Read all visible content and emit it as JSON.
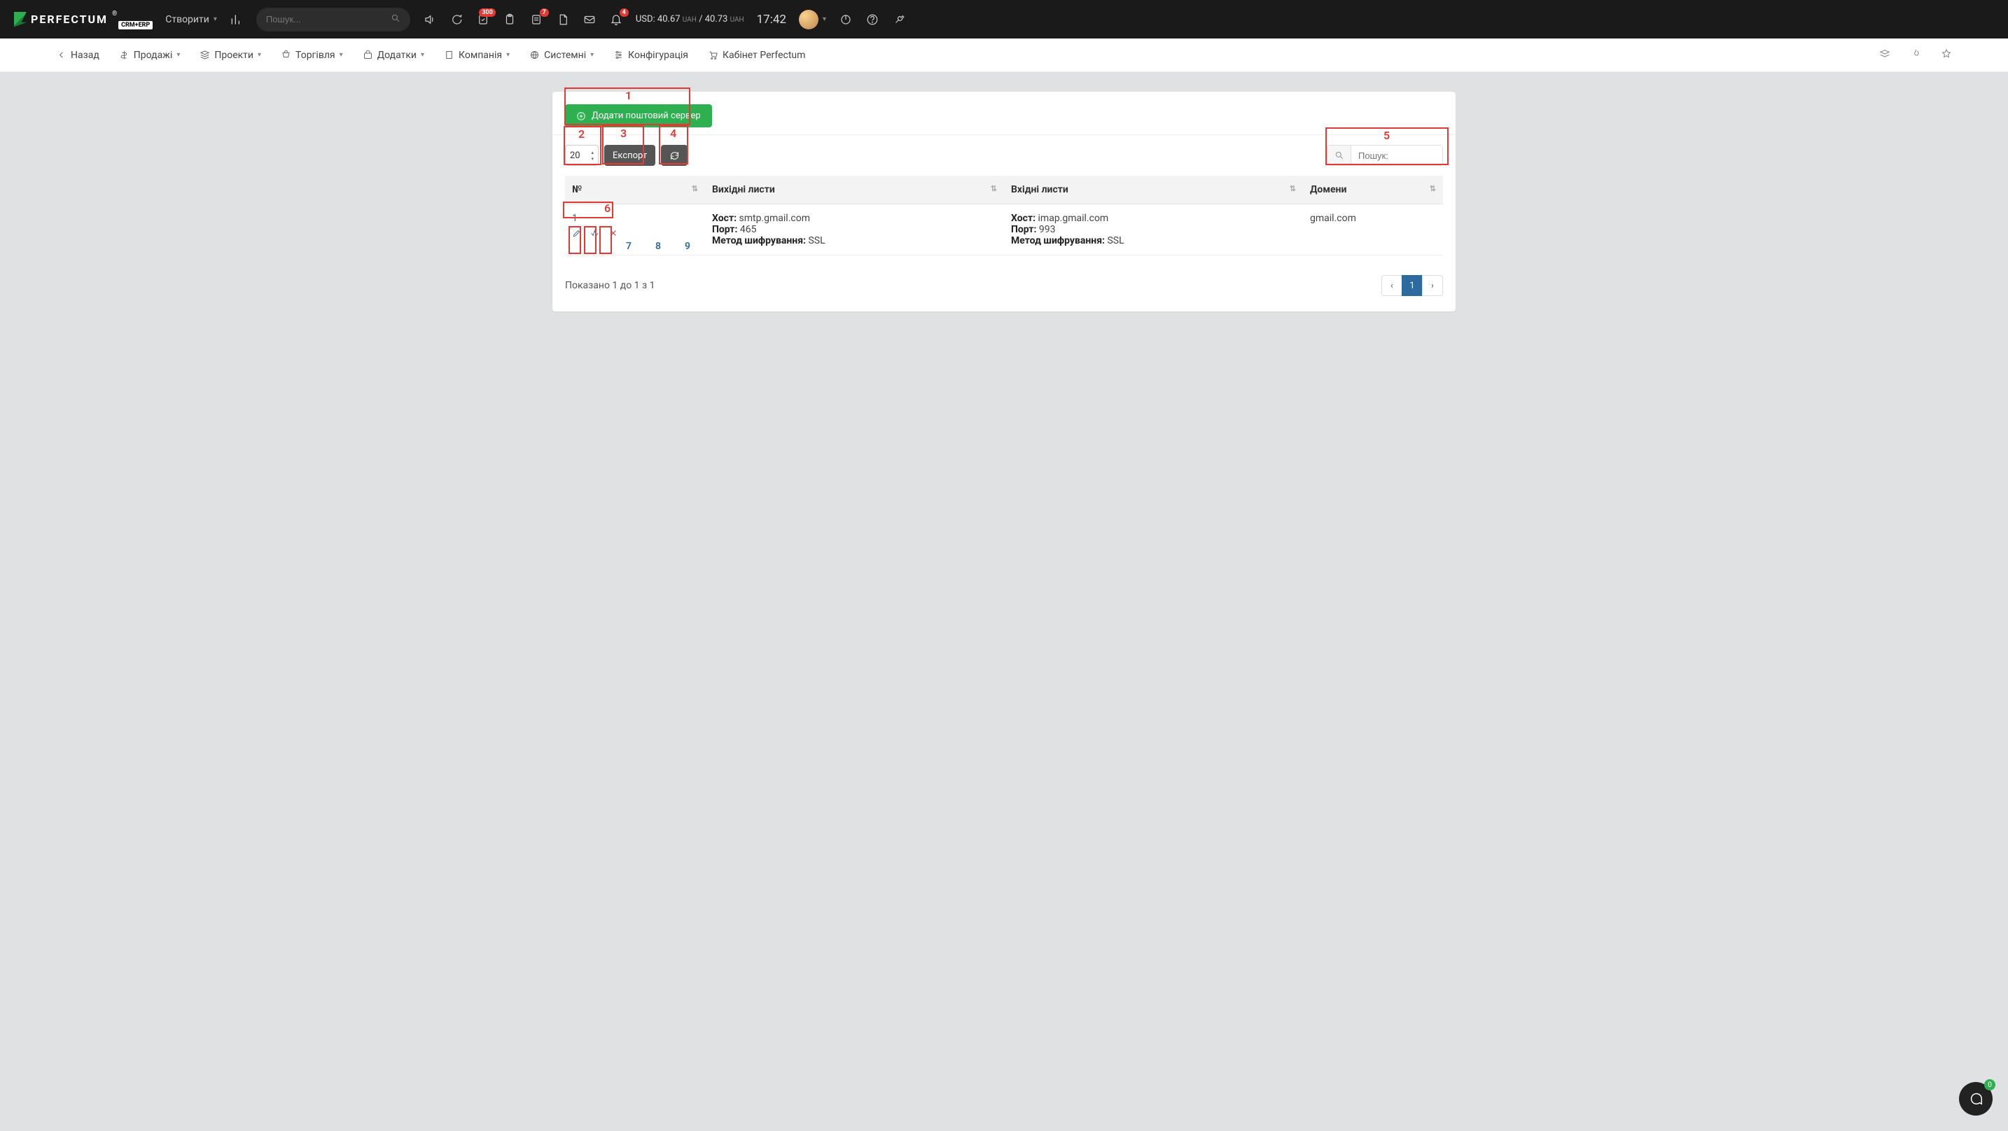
{
  "topbar": {
    "logo_text": "PERFECTUM",
    "logo_sub": "CRM+ERP",
    "logo_reg": "®",
    "create_label": "Створити",
    "search_placeholder": "Пошук...",
    "badges": {
      "todo": "300",
      "msg": "7",
      "bell": "4"
    },
    "currency": {
      "pair": "USD:",
      "buy": "40.67",
      "sell": "40.73",
      "unit": "UAH",
      "sep": "/"
    },
    "clock": "17:42"
  },
  "subnav": {
    "back": "Назад",
    "items": [
      "Продажі",
      "Проекти",
      "Торгівля",
      "Додатки",
      "Компанія",
      "Системні",
      "Конфігурація",
      "Кабінет Perfectum"
    ]
  },
  "page": {
    "add_button": "Додати поштовий сервер",
    "page_size_value": "20",
    "export_label": "Експорт",
    "table_search_placeholder": "Пошук:"
  },
  "annotations": [
    "1",
    "2",
    "3",
    "4",
    "5",
    "6",
    "7",
    "8",
    "9"
  ],
  "table": {
    "headers": [
      "№",
      "Вихідні листи",
      "Вхідні листи",
      "Домени"
    ],
    "labels": {
      "host": "Хост:",
      "port": "Порт:",
      "enc": "Метод шифрування:"
    },
    "rows": [
      {
        "num": "1",
        "out": {
          "host": "smtp.gmail.com",
          "port": "465",
          "enc": "SSL"
        },
        "in": {
          "host": "imap.gmail.com",
          "port": "993",
          "enc": "SSL"
        },
        "domain": "gmail.com"
      }
    ]
  },
  "footer": {
    "info": "Показано 1 до 1 з 1",
    "page": "1"
  },
  "chat": {
    "count": "0"
  }
}
